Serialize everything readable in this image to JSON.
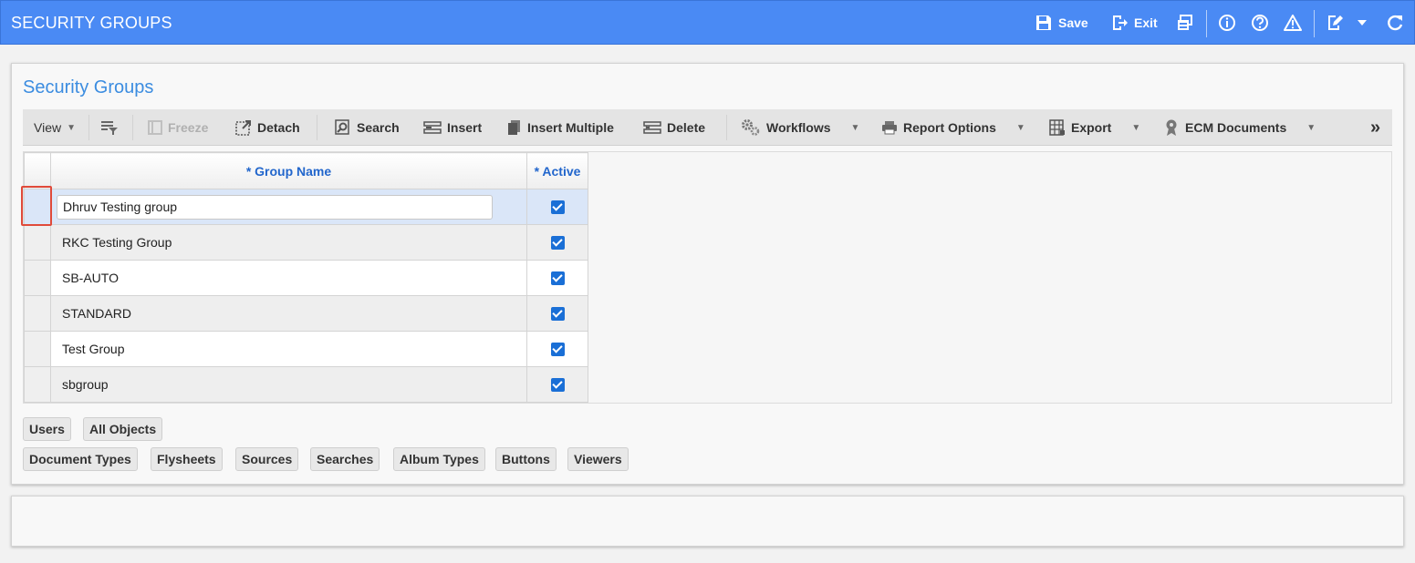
{
  "header": {
    "title": "SECURITY GROUPS",
    "save_label": "Save",
    "exit_label": "Exit",
    "icons": [
      "save-icon",
      "exit-icon",
      "print-icon",
      "info-icon",
      "help-icon",
      "warning-icon",
      "edit-icon",
      "chevron-down-icon",
      "refresh-icon"
    ],
    "bar_color": "#4a8af4"
  },
  "panel": {
    "title": "Security Groups"
  },
  "toolbar": {
    "view_label": "View",
    "freeze_label": "Freeze",
    "detach_label": "Detach",
    "search_label": "Search",
    "insert_label": "Insert",
    "insert_multiple_label": "Insert Multiple",
    "delete_label": "Delete",
    "workflows_label": "Workflows",
    "report_options_label": "Report Options",
    "export_label": "Export",
    "ecm_documents_label": "ECM Documents",
    "more_label": "»"
  },
  "grid": {
    "columns": [
      "* Group Name",
      "* Active"
    ],
    "rows": [
      {
        "name": "Dhruv Testing group",
        "active": true
      },
      {
        "name": "RKC Testing Group",
        "active": true
      },
      {
        "name": "SB-AUTO",
        "active": true
      },
      {
        "name": "STANDARD",
        "active": true
      },
      {
        "name": "Test Group",
        "active": true
      },
      {
        "name": "sbgroup",
        "active": true
      }
    ]
  },
  "buttons": {
    "users": "Users",
    "all_objects": "All Objects",
    "document_types": "Document Types",
    "flysheets": "Flysheets",
    "sources": "Sources",
    "searches": "Searches",
    "album_types": "Album Types",
    "buttons": "Buttons",
    "viewers": "Viewers"
  }
}
